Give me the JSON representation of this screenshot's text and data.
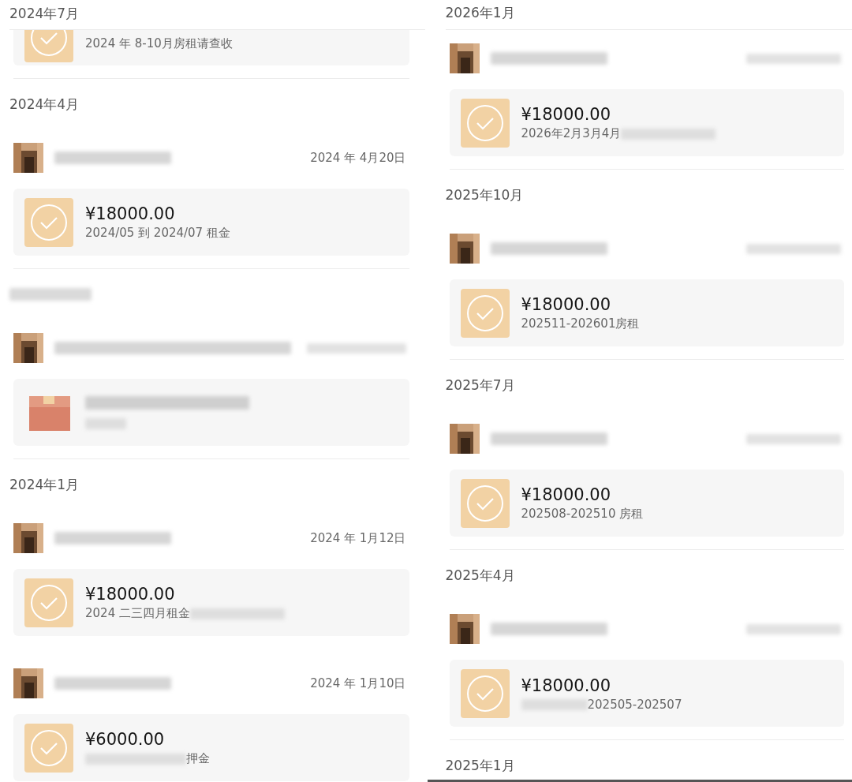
{
  "columns": [
    {
      "groups": [
        {
          "month": "2024年7月",
          "records": [
            {
              "kind": "transfer",
              "partial": true,
              "note": "2024 年 8-10月房租请查收"
            }
          ]
        },
        {
          "month": "2024年4月",
          "records": [
            {
              "kind": "transfer",
              "date": "2024 年 4月20日",
              "amount": "¥18000.00",
              "note": "2024/05 到 2024/07 租金"
            }
          ]
        },
        {
          "month_hidden": true,
          "records": [
            {
              "kind": "gift"
            }
          ]
        },
        {
          "month": "2024年1月",
          "records": [
            {
              "kind": "transfer",
              "date": "2024 年 1月12日",
              "amount": "¥18000.00",
              "note": "2024 二三四月租金",
              "redacted_after": true
            },
            {
              "kind": "transfer",
              "date": "2024 年 1月10日",
              "amount": "¥6000.00",
              "note": "押金",
              "redacted_before": true
            }
          ]
        }
      ]
    },
    {
      "groups": [
        {
          "month": "2026年1月",
          "records": [
            {
              "kind": "transfer",
              "amount": "¥18000.00",
              "note": "2026年2月3月4月",
              "redacted_after": true
            }
          ]
        },
        {
          "month": "2025年10月",
          "records": [
            {
              "kind": "transfer",
              "amount": "¥18000.00",
              "note": "202511-202601房租"
            }
          ]
        },
        {
          "month": "2025年7月",
          "records": [
            {
              "kind": "transfer",
              "amount": "¥18000.00",
              "note": "202508-202510 房租"
            }
          ]
        },
        {
          "month": "2025年4月",
          "records": [
            {
              "kind": "transfer",
              "amount": "¥18000.00",
              "note": "202505-202507",
              "redacted_before": true
            }
          ]
        },
        {
          "month": "2025年1月"
        }
      ]
    }
  ]
}
